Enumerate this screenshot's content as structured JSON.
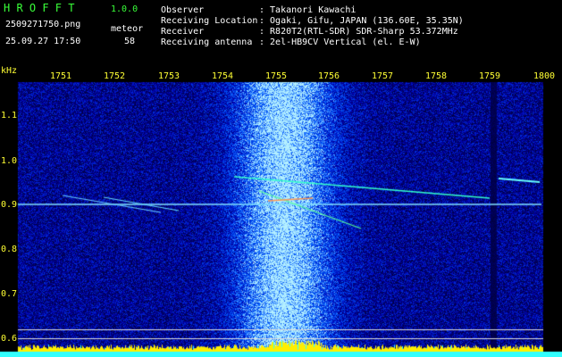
{
  "header": {
    "app_title": "H R O F F T",
    "version": "1.0.0",
    "filename": "2509271750.png",
    "datetime": "25.09.27 17:50",
    "meteor_label": "meteor",
    "meteor_count": "58",
    "info": [
      {
        "label": "Observer",
        "value": ": Takanori Kawachi"
      },
      {
        "label": "Receiving Location",
        "value": ": Ogaki, Gifu, JAPAN (136.60E, 35.35N)"
      },
      {
        "label": "Receiver",
        "value": ": R820T2(RTL-SDR) SDR-Sharp 53.372MHz"
      },
      {
        "label": "Receiving antenna",
        "value": ": 2el-HB9CV Vertical (el. E-W)"
      }
    ]
  },
  "axis": {
    "unit": "kHz",
    "time_ticks": [
      "1751",
      "1752",
      "1753",
      "1754",
      "1755",
      "1756",
      "1757",
      "1758",
      "1759",
      "1800"
    ],
    "freq_ticks": [
      "1.1",
      "1.0",
      "0.9",
      "0.8",
      "0.7",
      "0.6"
    ]
  },
  "colors": {
    "background": "#000000",
    "label_yellow": "#ffff33",
    "label_green": "#39ff39",
    "label_white": "#ffffff",
    "noise_blue": "#0a1aa0",
    "trail_cyan": "#33ffff",
    "bottom_bar": "#ffee00"
  }
}
